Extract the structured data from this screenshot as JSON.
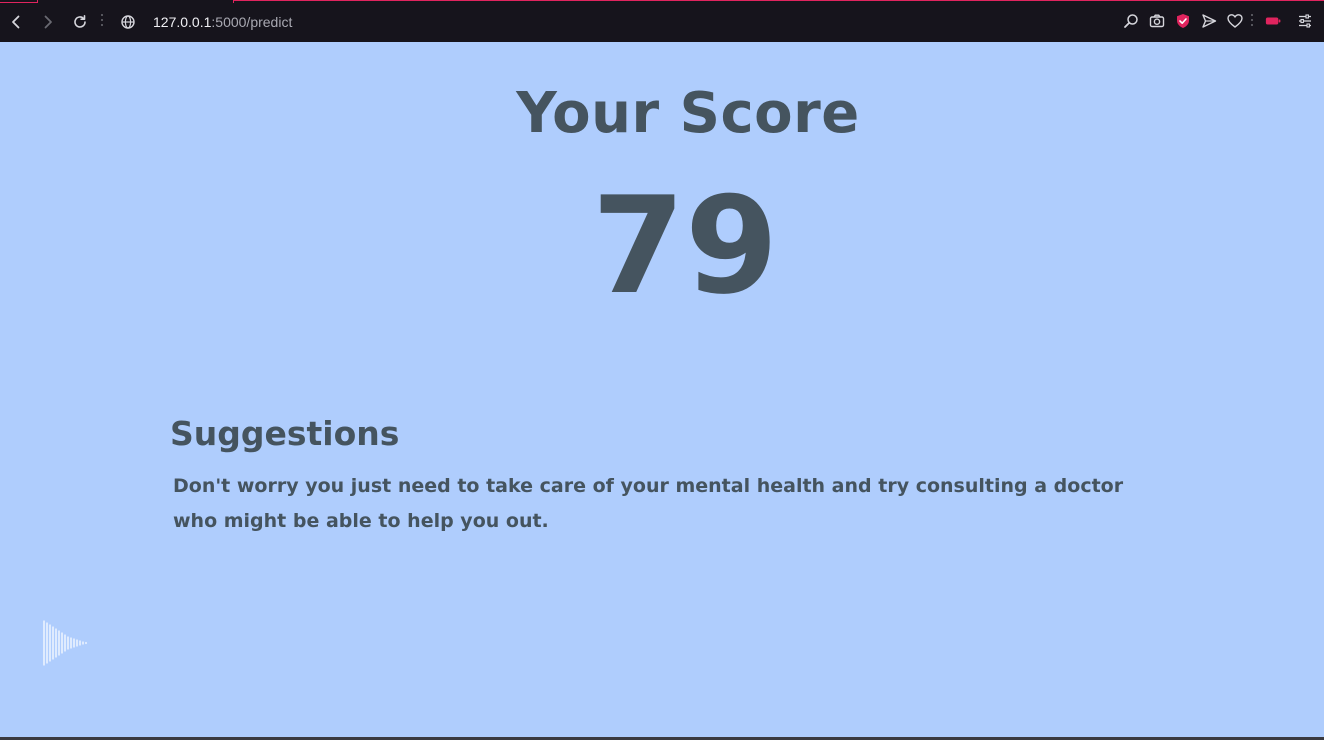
{
  "browser": {
    "url_host": "127.0.0.1",
    "url_path": ":5000/predict",
    "icons": [
      "back-icon",
      "forward-icon",
      "reload-icon",
      "site-info-icon",
      "search-icon",
      "camera-icon",
      "shield-icon",
      "send-icon",
      "heart-icon",
      "battery-icon",
      "settings-icon"
    ],
    "accent_color": "#e0245e"
  },
  "page": {
    "background_color": "#afcdfd",
    "text_color": "#45545f",
    "score_title": "Your Score",
    "score_value": "79",
    "suggestions_title": "Suggestions",
    "suggestions_text": "Don't worry you just need to take care of your mental health and try consulting a doctor who might be able to help you out.",
    "audio_widget_icon": "sound-wave-icon"
  }
}
